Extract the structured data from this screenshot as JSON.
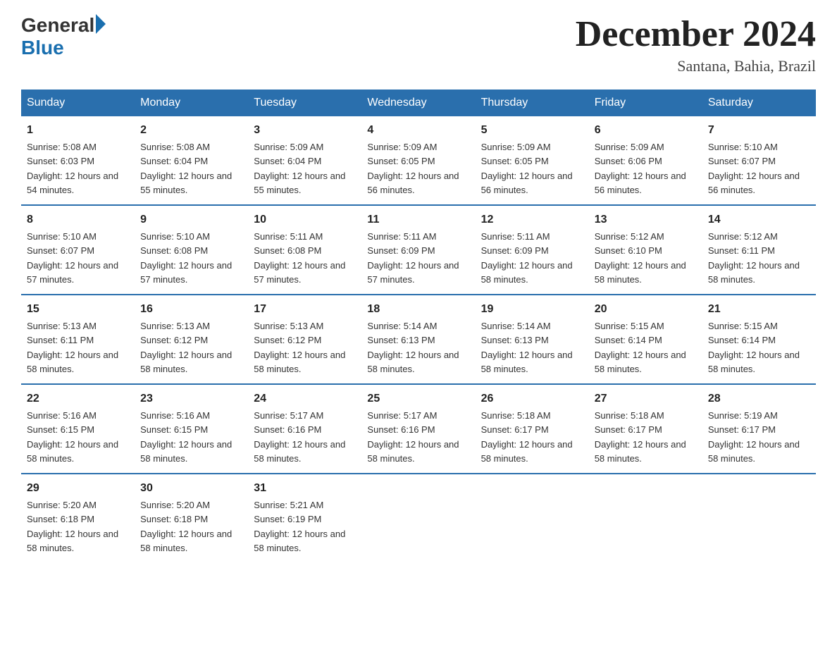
{
  "logo": {
    "general": "General",
    "blue": "Blue"
  },
  "title": "December 2024",
  "location": "Santana, Bahia, Brazil",
  "headers": [
    "Sunday",
    "Monday",
    "Tuesday",
    "Wednesday",
    "Thursday",
    "Friday",
    "Saturday"
  ],
  "weeks": [
    [
      {
        "day": "1",
        "sunrise": "5:08 AM",
        "sunset": "6:03 PM",
        "daylight": "12 hours and 54 minutes."
      },
      {
        "day": "2",
        "sunrise": "5:08 AM",
        "sunset": "6:04 PM",
        "daylight": "12 hours and 55 minutes."
      },
      {
        "day": "3",
        "sunrise": "5:09 AM",
        "sunset": "6:04 PM",
        "daylight": "12 hours and 55 minutes."
      },
      {
        "day": "4",
        "sunrise": "5:09 AM",
        "sunset": "6:05 PM",
        "daylight": "12 hours and 56 minutes."
      },
      {
        "day": "5",
        "sunrise": "5:09 AM",
        "sunset": "6:05 PM",
        "daylight": "12 hours and 56 minutes."
      },
      {
        "day": "6",
        "sunrise": "5:09 AM",
        "sunset": "6:06 PM",
        "daylight": "12 hours and 56 minutes."
      },
      {
        "day": "7",
        "sunrise": "5:10 AM",
        "sunset": "6:07 PM",
        "daylight": "12 hours and 56 minutes."
      }
    ],
    [
      {
        "day": "8",
        "sunrise": "5:10 AM",
        "sunset": "6:07 PM",
        "daylight": "12 hours and 57 minutes."
      },
      {
        "day": "9",
        "sunrise": "5:10 AM",
        "sunset": "6:08 PM",
        "daylight": "12 hours and 57 minutes."
      },
      {
        "day": "10",
        "sunrise": "5:11 AM",
        "sunset": "6:08 PM",
        "daylight": "12 hours and 57 minutes."
      },
      {
        "day": "11",
        "sunrise": "5:11 AM",
        "sunset": "6:09 PM",
        "daylight": "12 hours and 57 minutes."
      },
      {
        "day": "12",
        "sunrise": "5:11 AM",
        "sunset": "6:09 PM",
        "daylight": "12 hours and 58 minutes."
      },
      {
        "day": "13",
        "sunrise": "5:12 AM",
        "sunset": "6:10 PM",
        "daylight": "12 hours and 58 minutes."
      },
      {
        "day": "14",
        "sunrise": "5:12 AM",
        "sunset": "6:11 PM",
        "daylight": "12 hours and 58 minutes."
      }
    ],
    [
      {
        "day": "15",
        "sunrise": "5:13 AM",
        "sunset": "6:11 PM",
        "daylight": "12 hours and 58 minutes."
      },
      {
        "day": "16",
        "sunrise": "5:13 AM",
        "sunset": "6:12 PM",
        "daylight": "12 hours and 58 minutes."
      },
      {
        "day": "17",
        "sunrise": "5:13 AM",
        "sunset": "6:12 PM",
        "daylight": "12 hours and 58 minutes."
      },
      {
        "day": "18",
        "sunrise": "5:14 AM",
        "sunset": "6:13 PM",
        "daylight": "12 hours and 58 minutes."
      },
      {
        "day": "19",
        "sunrise": "5:14 AM",
        "sunset": "6:13 PM",
        "daylight": "12 hours and 58 minutes."
      },
      {
        "day": "20",
        "sunrise": "5:15 AM",
        "sunset": "6:14 PM",
        "daylight": "12 hours and 58 minutes."
      },
      {
        "day": "21",
        "sunrise": "5:15 AM",
        "sunset": "6:14 PM",
        "daylight": "12 hours and 58 minutes."
      }
    ],
    [
      {
        "day": "22",
        "sunrise": "5:16 AM",
        "sunset": "6:15 PM",
        "daylight": "12 hours and 58 minutes."
      },
      {
        "day": "23",
        "sunrise": "5:16 AM",
        "sunset": "6:15 PM",
        "daylight": "12 hours and 58 minutes."
      },
      {
        "day": "24",
        "sunrise": "5:17 AM",
        "sunset": "6:16 PM",
        "daylight": "12 hours and 58 minutes."
      },
      {
        "day": "25",
        "sunrise": "5:17 AM",
        "sunset": "6:16 PM",
        "daylight": "12 hours and 58 minutes."
      },
      {
        "day": "26",
        "sunrise": "5:18 AM",
        "sunset": "6:17 PM",
        "daylight": "12 hours and 58 minutes."
      },
      {
        "day": "27",
        "sunrise": "5:18 AM",
        "sunset": "6:17 PM",
        "daylight": "12 hours and 58 minutes."
      },
      {
        "day": "28",
        "sunrise": "5:19 AM",
        "sunset": "6:17 PM",
        "daylight": "12 hours and 58 minutes."
      }
    ],
    [
      {
        "day": "29",
        "sunrise": "5:20 AM",
        "sunset": "6:18 PM",
        "daylight": "12 hours and 58 minutes."
      },
      {
        "day": "30",
        "sunrise": "5:20 AM",
        "sunset": "6:18 PM",
        "daylight": "12 hours and 58 minutes."
      },
      {
        "day": "31",
        "sunrise": "5:21 AM",
        "sunset": "6:19 PM",
        "daylight": "12 hours and 58 minutes."
      },
      null,
      null,
      null,
      null
    ]
  ],
  "labels": {
    "sunrise_prefix": "Sunrise: ",
    "sunset_prefix": "Sunset: ",
    "daylight_prefix": "Daylight: "
  }
}
